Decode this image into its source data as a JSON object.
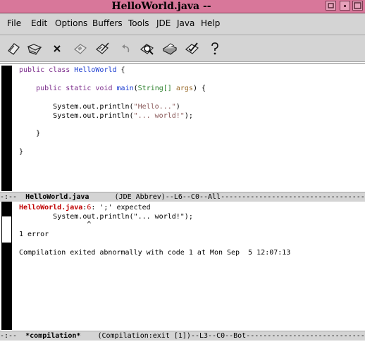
{
  "window": {
    "title": "HelloWorld.java  --"
  },
  "menu": {
    "items": [
      "File",
      "Edit",
      "Options",
      "Buffers",
      "Tools",
      "JDE",
      "Java",
      "Help"
    ]
  },
  "toolbar": {
    "tools": [
      "open-file-icon",
      "open-directory-icon",
      "close-icon",
      "save-icon",
      "save-as-icon",
      "undo-icon",
      "search-icon",
      "print-icon",
      "compile-icon",
      "help-icon"
    ]
  },
  "editor": {
    "line1": {
      "kw1": "public",
      "kw2": "class",
      "name": "HelloWorld",
      "brace": " {"
    },
    "line3": {
      "kw1": "public",
      "kw2": "static",
      "kw3": "void",
      "fn": "main",
      "open": "(",
      "type": "String[]",
      "var": "args",
      "close": ") {"
    },
    "line5": {
      "pre": "System.out.println(",
      "str": "\"Hello...\"",
      "post": ")"
    },
    "line6": {
      "pre": "System.out.println(",
      "str": "\"... world!\"",
      "post": ");"
    },
    "line8": "}",
    "line10": "}"
  },
  "modeline_top": {
    "prefix": "-:--  ",
    "buffer": "HelloWorld.java",
    "rest": "      (JDE Abbrev)--L6--C0--All----------------------------------"
  },
  "compilation": {
    "err_file": "HelloWorld.java",
    "err_sep": ":",
    "err_lineno": "6",
    "err_msg": ": ';' expected",
    "src_line": "System.out.println(\"... world!\");",
    "caret": "^",
    "summary": "1 error",
    "exit_msg": "Compilation exited abnormally with code 1 at Mon Sep  5 12:07:13"
  },
  "modeline_bottom": {
    "prefix": "-:--  ",
    "buffer": "*compilation*",
    "rest": "    (Compilation:exit [1])--L3--C0--Bot----------------------------"
  },
  "colors": {
    "titlebar": "#d8779a",
    "keyword": "#7b2b8b",
    "function": "#1a3bd0",
    "type": "#2a7f2a",
    "variable": "#9a6b2b",
    "string": "#8a5a5a",
    "error": "#c00000"
  }
}
